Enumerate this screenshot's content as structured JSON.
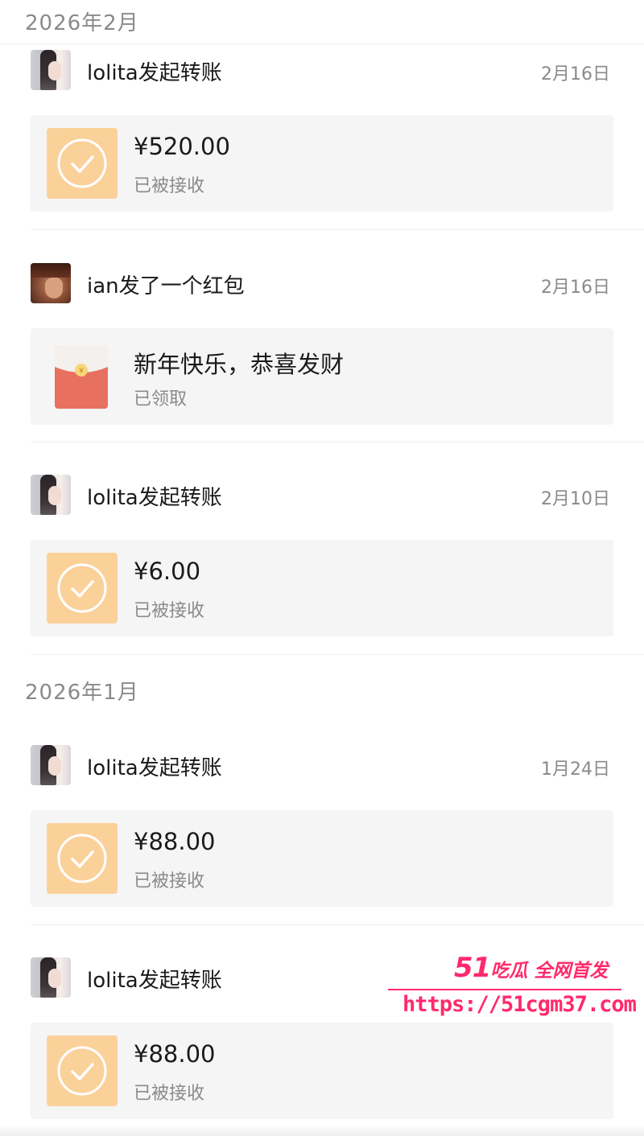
{
  "months": [
    {
      "label": "2026年2月"
    },
    {
      "label": "2026年1月"
    }
  ],
  "records": [
    {
      "avatar": "lolita",
      "title": "lolita发起转账",
      "date": "2月16日",
      "type": "transfer",
      "amount": "¥520.00",
      "status": "已被接收",
      "icon": "check-circle-icon"
    },
    {
      "avatar": "ian",
      "title": "ian发了一个红包",
      "date": "2月16日",
      "type": "red-packet",
      "amount": "新年快乐，恭喜发财",
      "status": "已领取",
      "icon": "red-packet-icon"
    },
    {
      "avatar": "lolita",
      "title": "lolita发起转账",
      "date": "2月10日",
      "type": "transfer",
      "amount": "¥6.00",
      "status": "已被接收",
      "icon": "check-circle-icon"
    },
    {
      "avatar": "lolita",
      "title": "lolita发起转账",
      "date": "1月24日",
      "type": "transfer",
      "amount": "¥88.00",
      "status": "已被接收",
      "icon": "check-circle-icon"
    },
    {
      "avatar": "lolita",
      "title": "lolita发起转账",
      "date": "",
      "type": "transfer",
      "amount": "¥88.00",
      "status": "已被接收",
      "icon": "check-circle-icon"
    }
  ],
  "watermark": {
    "brand_number": "51",
    "brand_text": "吃瓜 全网首发",
    "url": "https://51cgm37.com"
  },
  "colors": {
    "transfer_tile": "#fbd19a",
    "red_packet": "#e8705f",
    "watermark": "#ff2a6d",
    "card_background": "#f5f5f5"
  }
}
